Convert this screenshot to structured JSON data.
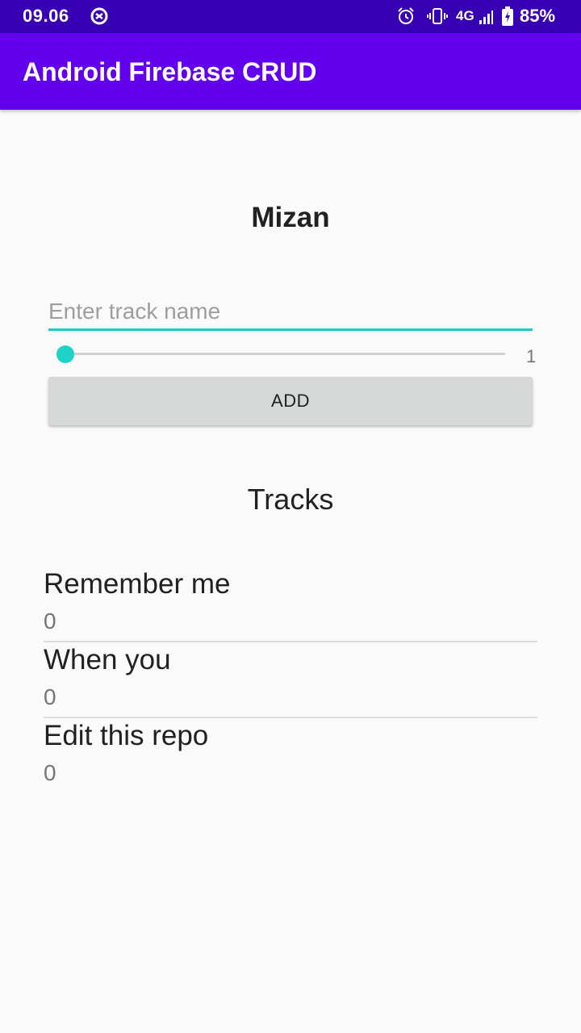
{
  "status_bar": {
    "time": "09.06",
    "network": "4G",
    "battery": "85%",
    "icons": [
      "app-notification-icon",
      "alarm-icon",
      "vibrate-icon",
      "signal-icon",
      "battery-icon"
    ]
  },
  "app_bar": {
    "title": "Android Firebase CRUD"
  },
  "artist": {
    "name": "Mizan"
  },
  "form": {
    "track_placeholder": "Enter track name",
    "track_value": "",
    "rating_value": "1",
    "add_label": "ADD"
  },
  "tracks": {
    "heading": "Tracks",
    "items": [
      {
        "name": "Remember me",
        "rating": "0"
      },
      {
        "name": "When you",
        "rating": "0"
      },
      {
        "name": "Edit this repo",
        "rating": "0"
      }
    ]
  },
  "colors": {
    "status_bar": "#3700b3",
    "app_bar": "#6200ee",
    "accent": "#26c6c6",
    "background": "#fafafa"
  }
}
